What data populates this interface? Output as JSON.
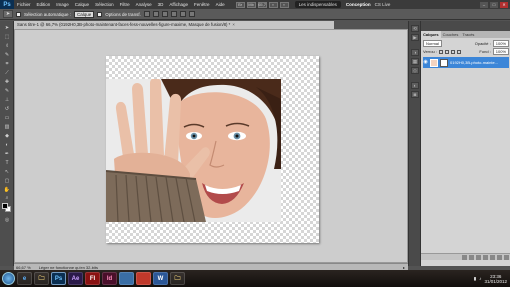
{
  "menubar": {
    "logo": "Ps",
    "items": [
      "Fichier",
      "Edition",
      "Image",
      "Calque",
      "Sélection",
      "Filtre",
      "Analyse",
      "3D",
      "Affichage",
      "Fenêtre",
      "Aide"
    ],
    "icons": [
      "Br",
      "Mb",
      "65,7",
      "▪",
      "▪"
    ],
    "workspace_button": "Les indispensables",
    "workspace_current": "Conception",
    "cslive": "CS Live",
    "window_controls": [
      "–",
      "□",
      "✕"
    ]
  },
  "options": {
    "auto_select_label": "Sélection automatique :",
    "auto_select_value": "Calque",
    "transform_label": "Options de transf."
  },
  "document": {
    "tab_title": "Sans titre-1 @ 66,7% (0192H0,3B-photo-maintenant-faces-fess-nouvelles-figure-maxime, Masque de fusion/8) *",
    "close": "×"
  },
  "status": {
    "zoom": "66,67 %",
    "info": "Léger ne fonctionne qu'en 32-bits"
  },
  "layers_panel": {
    "tabs": [
      "Calques",
      "Couches",
      "Tracés"
    ],
    "active_tab": "Calques",
    "blend_mode": "Normal",
    "opacity_label": "Opacité :",
    "opacity_value": "100%",
    "lock_label": "Verrou :",
    "fill_label": "Fond :",
    "fill_value": "100%",
    "layer_name": "0192H0,3B-photo-mainte..."
  },
  "taskbar": {
    "apps": [
      "e",
      "🗀",
      "Ps",
      "Ae",
      "Fl",
      "Id",
      "",
      "",
      "W",
      "🗀"
    ],
    "active_app_index": 2,
    "time": "23:36",
    "date": "31/01/2012"
  },
  "colors": {
    "accent_selected": "#3c86d8",
    "ps_blue": "#0a2f52"
  }
}
